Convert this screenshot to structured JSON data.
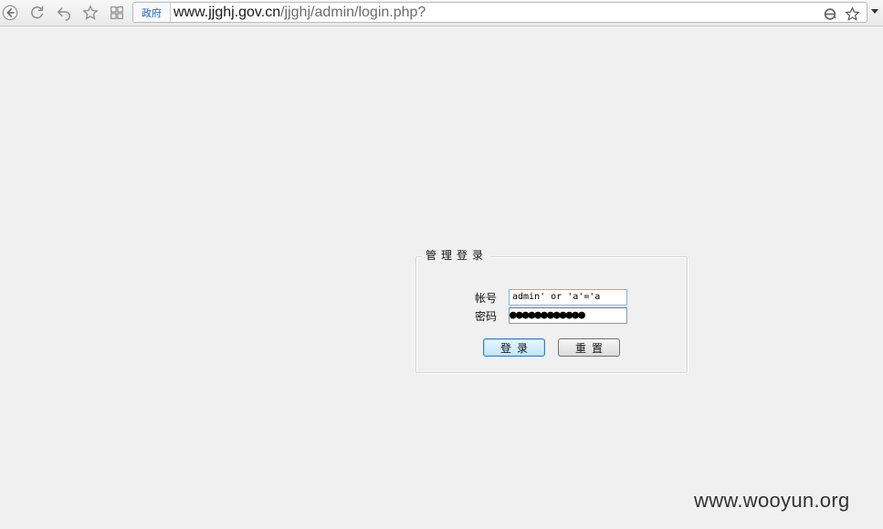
{
  "browser": {
    "gov_tag": "政府",
    "url_host": "www.jjghj.gov.cn",
    "url_path": "/jjghj/admin/login.php?",
    "icons": [
      "back-icon",
      "refresh-icon",
      "undo-icon",
      "favorite-icon",
      "apps-icon",
      "ie-mode-icon",
      "bookmark-star-icon",
      "menu-caret-icon"
    ]
  },
  "login": {
    "legend": "管理登录",
    "username_label": "帐号",
    "password_label": "密码",
    "username_value": "admin' or 'a'='a",
    "password_mask": "●●●●●●●●●●●●",
    "login_button": "登录",
    "reset_button": "重置"
  },
  "watermark": "www.wooyun.org",
  "colors": {
    "page_bg": "#f0f0f0",
    "link_blue": "#1a66b5",
    "input_focus": "#7eb4ea"
  }
}
